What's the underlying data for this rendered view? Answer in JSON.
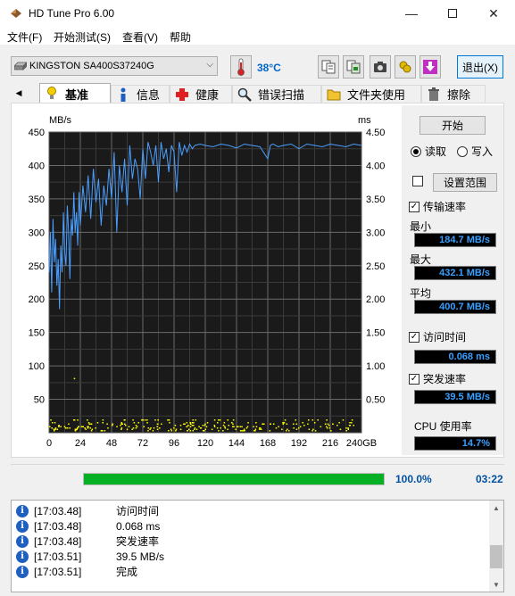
{
  "window": {
    "title": "HD Tune Pro 6.00"
  },
  "menu": [
    "文件(F)",
    "开始测试(S)",
    "查看(V)",
    "帮助"
  ],
  "toolbar": {
    "drive": "KINGSTON SA400S37240G",
    "temperature": "38°C",
    "exit_label": "退出(X)"
  },
  "tabs": [
    {
      "label": "基准",
      "icon": "bulb-icon",
      "active": true
    },
    {
      "label": "信息",
      "icon": "info-icon"
    },
    {
      "label": "健康",
      "icon": "health-cross-icon"
    },
    {
      "label": "错误扫描",
      "icon": "magnifier-icon"
    },
    {
      "label": "文件夹使用",
      "icon": "folder-icon"
    },
    {
      "label": "擦除",
      "icon": "trash-icon"
    }
  ],
  "side": {
    "start_label": "开始",
    "read_label": "读取",
    "write_label": "写入",
    "mode": "read",
    "range_label": "设置范围",
    "range_checked": false,
    "transfer_label": "传输速率",
    "transfer_checked": true,
    "min_label": "最小",
    "min_value": "184.7 MB/s",
    "max_label": "最大",
    "max_value": "432.1 MB/s",
    "avg_label": "平均",
    "avg_value": "400.7 MB/s",
    "access_label": "访问时间",
    "access_checked": true,
    "access_value": "0.068 ms",
    "burst_label": "突发速率",
    "burst_checked": true,
    "burst_value": "39.5 MB/s",
    "cpu_label": "CPU 使用率",
    "cpu_value": "14.7%"
  },
  "progress": {
    "percent": 100.0,
    "percent_text": "100.0%",
    "time": "03:22"
  },
  "log": [
    {
      "time": "[17:03.48]",
      "text": "访问时间"
    },
    {
      "time": "[17:03.48]",
      "text": "0.068 ms"
    },
    {
      "time": "[17:03.48]",
      "text": "突发速率"
    },
    {
      "time": "[17:03.51]",
      "text": "39.5 MB/s"
    },
    {
      "time": "[17:03.51]",
      "text": "完成"
    }
  ],
  "colors": {
    "transfer_line": "#4a9eff",
    "access_dots": "#ffff00",
    "grid": "#6a6a6a",
    "plot_bg": "#1a1a1a",
    "progress": "#06b025",
    "value_text": "#3aa0ff"
  },
  "chart_data": {
    "type": "line",
    "y_left_label": "MB/s",
    "y_right_label": "ms",
    "x_ticks": [
      "0",
      "24",
      "48",
      "72",
      "96",
      "120",
      "144",
      "168",
      "192",
      "216",
      "240GB"
    ],
    "y_left_ticks": [
      "450",
      "400",
      "350",
      "300",
      "250",
      "200",
      "150",
      "100",
      "50"
    ],
    "y_right_ticks": [
      "4.50",
      "4.00",
      "3.50",
      "3.00",
      "2.50",
      "2.00",
      "1.50",
      "1.00",
      "0.50"
    ],
    "xlim": [
      0,
      240
    ],
    "ylim_left": [
      0,
      450
    ],
    "ylim_right": [
      0,
      4.5
    ],
    "series": [
      {
        "name": "传输速率",
        "x": [
          0,
          1,
          2,
          3,
          4,
          5,
          6,
          7,
          8,
          9,
          10,
          11,
          12,
          13,
          14,
          15,
          16,
          17,
          18,
          19,
          20,
          21,
          22,
          23,
          24,
          26,
          28,
          30,
          32,
          34,
          36,
          38,
          40,
          42,
          44,
          46,
          48,
          50,
          52,
          54,
          56,
          58,
          60,
          62,
          64,
          66,
          68,
          70,
          72,
          74,
          76,
          78,
          80,
          82,
          84,
          86,
          88,
          90,
          92,
          94,
          96,
          98,
          100,
          102,
          104,
          106,
          108,
          110,
          112,
          116,
          120,
          126,
          132,
          138,
          144,
          150,
          156,
          162,
          168,
          170,
          172,
          176,
          180,
          186,
          192,
          198,
          204,
          210,
          216,
          222,
          228,
          234,
          240
        ],
        "y": [
          240,
          300,
          210,
          320,
          255,
          290,
          220,
          260,
          185,
          280,
          240,
          330,
          270,
          250,
          340,
          300,
          230,
          320,
          295,
          360,
          300,
          330,
          280,
          360,
          310,
          370,
          330,
          385,
          320,
          395,
          345,
          380,
          310,
          370,
          340,
          395,
          350,
          420,
          300,
          400,
          360,
          410,
          340,
          430,
          380,
          410,
          395,
          350,
          425,
          380,
          435,
          420,
          400,
          430,
          375,
          435,
          410,
          425,
          390,
          430,
          420,
          360,
          435,
          415,
          430,
          420,
          432,
          425,
          430,
          432,
          430,
          428,
          432,
          430,
          426,
          432,
          430,
          428,
          410,
          430,
          432,
          428,
          430,
          432,
          425,
          432,
          430,
          428,
          432,
          430,
          428,
          432,
          430
        ]
      },
      {
        "name": "访问时间",
        "description_values_ms": [
          0.04,
          0.06,
          0.08,
          0.1,
          0.12,
          0.14,
          0.16,
          0.2
        ]
      }
    ]
  }
}
